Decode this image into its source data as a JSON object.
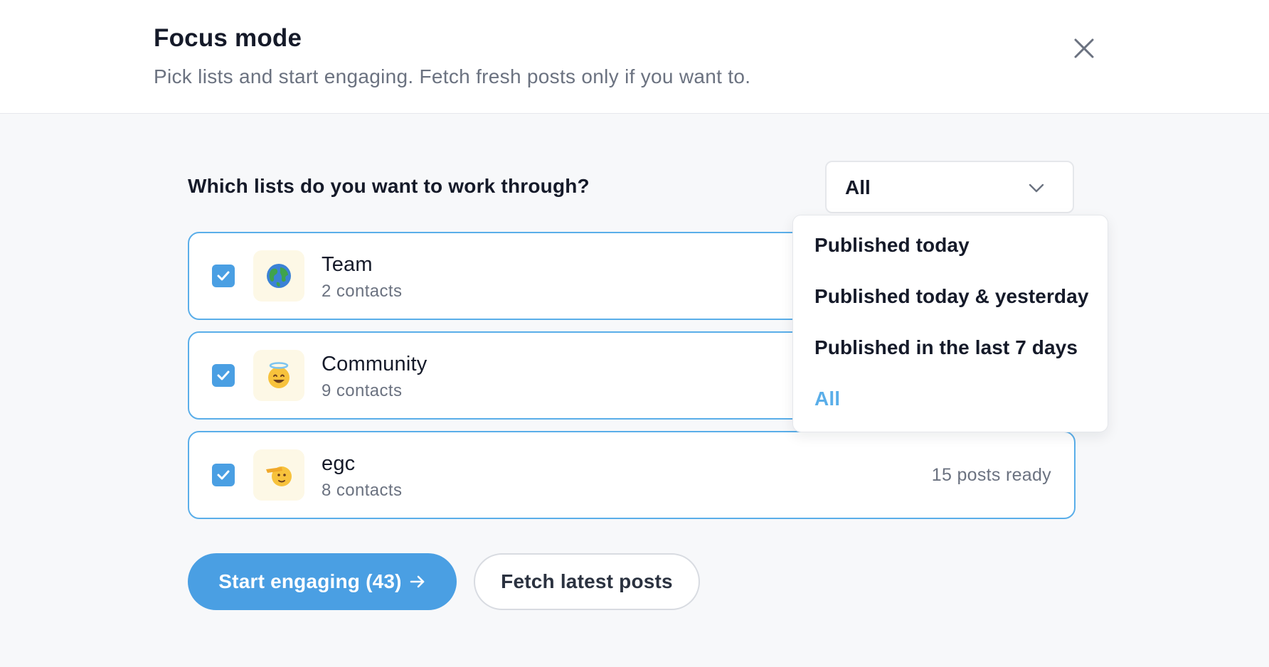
{
  "header": {
    "title": "Focus mode",
    "subtitle": "Pick lists and start engaging. Fetch fresh posts only if you want to.",
    "close_icon": "close-icon"
  },
  "main": {
    "question": "Which lists do you want to work through?",
    "filter": {
      "selected": "All",
      "options": [
        "Published today",
        "Published today & yesterday",
        "Published in the last 7 days",
        "All"
      ]
    },
    "lists": [
      {
        "name": "Team",
        "contacts": "2 contacts",
        "icon": "globe-icon",
        "checked": true,
        "posts_ready": ""
      },
      {
        "name": "Community",
        "contacts": "9 contacts",
        "icon": "halo-smile-icon",
        "checked": true,
        "posts_ready": ""
      },
      {
        "name": "egc",
        "contacts": "8 contacts",
        "icon": "saluting-face-icon",
        "checked": true,
        "posts_ready": "15 posts ready"
      }
    ]
  },
  "actions": {
    "start_label": "Start engaging (43)",
    "fetch_label": "Fetch latest posts"
  },
  "colors": {
    "accent": "#4a9fe3",
    "card_border": "#5aaee9",
    "muted_text": "#6b7280",
    "emoji_tile_bg": "#fdf8e6"
  }
}
